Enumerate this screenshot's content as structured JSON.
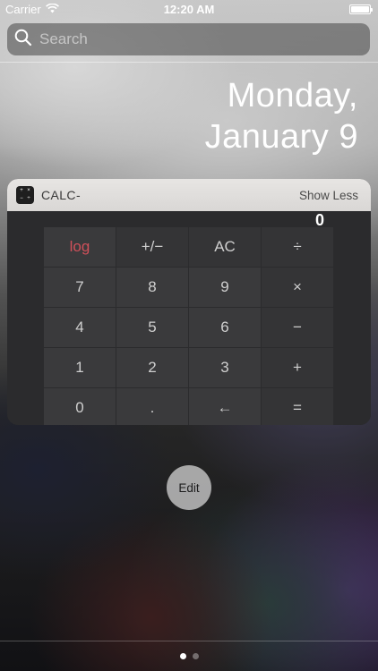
{
  "status_bar": {
    "carrier": "Carrier",
    "time": "12:20 AM"
  },
  "search": {
    "placeholder": "Search"
  },
  "date": {
    "line1": "Monday,",
    "line2": "January 9"
  },
  "widget": {
    "app_name": "CALC-",
    "show_less_label": "Show Less",
    "display_value": "0",
    "keys": [
      {
        "label": "log",
        "name": "key-log",
        "style": "log"
      },
      {
        "label": "+/−",
        "name": "key-plus-minus",
        "style": "op"
      },
      {
        "label": "AC",
        "name": "key-ac",
        "style": "op"
      },
      {
        "label": "÷",
        "name": "key-divide",
        "style": "op"
      },
      {
        "label": "7",
        "name": "key-7",
        "style": ""
      },
      {
        "label": "8",
        "name": "key-8",
        "style": ""
      },
      {
        "label": "9",
        "name": "key-9",
        "style": ""
      },
      {
        "label": "×",
        "name": "key-multiply",
        "style": "op"
      },
      {
        "label": "4",
        "name": "key-4",
        "style": ""
      },
      {
        "label": "5",
        "name": "key-5",
        "style": ""
      },
      {
        "label": "6",
        "name": "key-6",
        "style": ""
      },
      {
        "label": "−",
        "name": "key-minus",
        "style": "op"
      },
      {
        "label": "1",
        "name": "key-1",
        "style": ""
      },
      {
        "label": "2",
        "name": "key-2",
        "style": ""
      },
      {
        "label": "3",
        "name": "key-3",
        "style": ""
      },
      {
        "label": "+",
        "name": "key-plus",
        "style": "op"
      },
      {
        "label": "0",
        "name": "key-0",
        "style": ""
      },
      {
        "label": ".",
        "name": "key-decimal",
        "style": ""
      },
      {
        "label": "←",
        "name": "key-backspace",
        "style": ""
      },
      {
        "label": "=",
        "name": "key-equals",
        "style": "op"
      }
    ]
  },
  "edit_label": "Edit",
  "page_dots": {
    "count": 2,
    "active_index": 0
  }
}
